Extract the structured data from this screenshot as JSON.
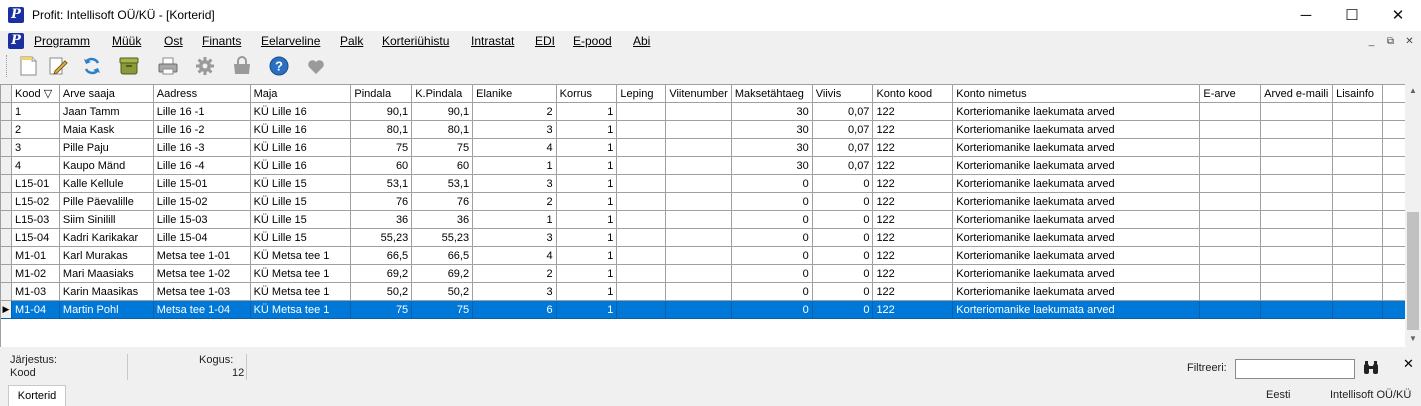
{
  "window": {
    "title": "Profit: Intellisoft OÜ/KÜ - [Korterid]",
    "icon": "P",
    "minimize": "─",
    "maximize": "☐",
    "close": "✕"
  },
  "menu": {
    "items": [
      "Programm",
      "Müük",
      "Ost",
      "Finants",
      "Eelarveline",
      "Palk",
      "Korteriühistu",
      "Intrastat",
      "EDI",
      "E-pood",
      "Abi"
    ],
    "mdi_min": "_",
    "mdi_restore": "⧉",
    "mdi_close": "✕"
  },
  "toolbar": {
    "icons": [
      "new-document-icon",
      "edit-icon",
      "refresh-icon",
      "archive-icon",
      "print-icon",
      "settings-gear-icon",
      "bag-icon",
      "help-icon",
      "favorite-heart-icon"
    ]
  },
  "grid": {
    "columns": [
      "Kood ▽",
      "Arve saaja",
      "Aadress",
      "Maja",
      "Pindala",
      "K.Pindala",
      "Elanike",
      "Korrus",
      "Leping",
      "Viitenumber",
      "Maksetähtaeg",
      "Viivis",
      "Konto kood",
      "Konto nimetus",
      "E-arve",
      "Arved e-maili",
      "Lisainfo"
    ],
    "rows": [
      [
        "1",
        "Jaan Tamm",
        "Lille 16 -1",
        "KÜ Lille 16",
        "90,1",
        "90,1",
        "2",
        "1",
        "",
        "",
        "30",
        "0,07",
        "122",
        "Korteriomanike laekumata arved",
        "",
        "",
        ""
      ],
      [
        "2",
        "Maia Kask",
        "Lille 16 -2",
        "KÜ Lille 16",
        "80,1",
        "80,1",
        "3",
        "1",
        "",
        "",
        "30",
        "0,07",
        "122",
        "Korteriomanike laekumata arved",
        "",
        "",
        ""
      ],
      [
        "3",
        "Pille Paju",
        "Lille 16 -3",
        "KÜ Lille 16",
        "75",
        "75",
        "4",
        "1",
        "",
        "",
        "30",
        "0,07",
        "122",
        "Korteriomanike laekumata arved",
        "",
        "",
        ""
      ],
      [
        "4",
        "Kaupo Mänd",
        "Lille 16 -4",
        "KÜ Lille 16",
        "60",
        "60",
        "1",
        "1",
        "",
        "",
        "30",
        "0,07",
        "122",
        "Korteriomanike laekumata arved",
        "",
        "",
        ""
      ],
      [
        "L15-01",
        "Kalle Kellule",
        "Lille 15-01",
        "KÜ Lille 15",
        "53,1",
        "53,1",
        "3",
        "1",
        "",
        "",
        "0",
        "0",
        "122",
        "Korteriomanike laekumata arved",
        "",
        "",
        ""
      ],
      [
        "L15-02",
        "Pille Päevalille",
        "Lille 15-02",
        "KÜ Lille 15",
        "76",
        "76",
        "2",
        "1",
        "",
        "",
        "0",
        "0",
        "122",
        "Korteriomanike laekumata arved",
        "",
        "",
        ""
      ],
      [
        "L15-03",
        "Siim Sinilill",
        "Lille 15-03",
        "KÜ Lille 15",
        "36",
        "36",
        "1",
        "1",
        "",
        "",
        "0",
        "0",
        "122",
        "Korteriomanike laekumata arved",
        "",
        "",
        ""
      ],
      [
        "L15-04",
        "Kadri Karikakar",
        "Lille 15-04",
        "KÜ Lille 15",
        "55,23",
        "55,23",
        "3",
        "1",
        "",
        "",
        "0",
        "0",
        "122",
        "Korteriomanike laekumata arved",
        "",
        "",
        ""
      ],
      [
        "M1-01",
        "Karl Murakas",
        " Metsa tee 1-01",
        "KÜ Metsa tee 1",
        "66,5",
        "66,5",
        "4",
        "1",
        "",
        "",
        "0",
        "0",
        "122",
        "Korteriomanike laekumata arved",
        "",
        "",
        ""
      ],
      [
        "M1-02",
        "Mari Maasiaks",
        " Metsa tee 1-02",
        "KÜ Metsa tee 1",
        "69,2",
        "69,2",
        "2",
        "1",
        "",
        "",
        "0",
        "0",
        "122",
        "Korteriomanike laekumata arved",
        "",
        "",
        ""
      ],
      [
        "M1-03",
        "Karin Maasikas",
        " Metsa tee 1-03",
        "KÜ Metsa tee 1",
        "50,2",
        "50,2",
        "3",
        "1",
        "",
        "",
        "0",
        "0",
        "122",
        "Korteriomanike laekumata arved",
        "",
        "",
        ""
      ],
      [
        "M1-04",
        "Martin Pohl",
        " Metsa tee 1-04",
        "KÜ Metsa tee 1",
        "75",
        "75",
        "6",
        "1",
        "",
        "",
        "0",
        "0",
        "122",
        "Korteriomanike laekumata arved",
        "",
        "",
        ""
      ]
    ],
    "selected_index": 11,
    "selected_marker": "▶",
    "numeric_columns": [
      4,
      5,
      6,
      7,
      10,
      11
    ],
    "selection_color": "#0078d7"
  },
  "status": {
    "sort_label": "Järjestus:",
    "sort_value": "Kood",
    "count_label": "Kogus:",
    "count_value": "12",
    "filter_label": "Filtreeri:",
    "filter_value": "",
    "filter_close": "✕",
    "language": "Eesti",
    "company": "Intellisoft OÜ/KÜ",
    "tab": "Korterid"
  }
}
